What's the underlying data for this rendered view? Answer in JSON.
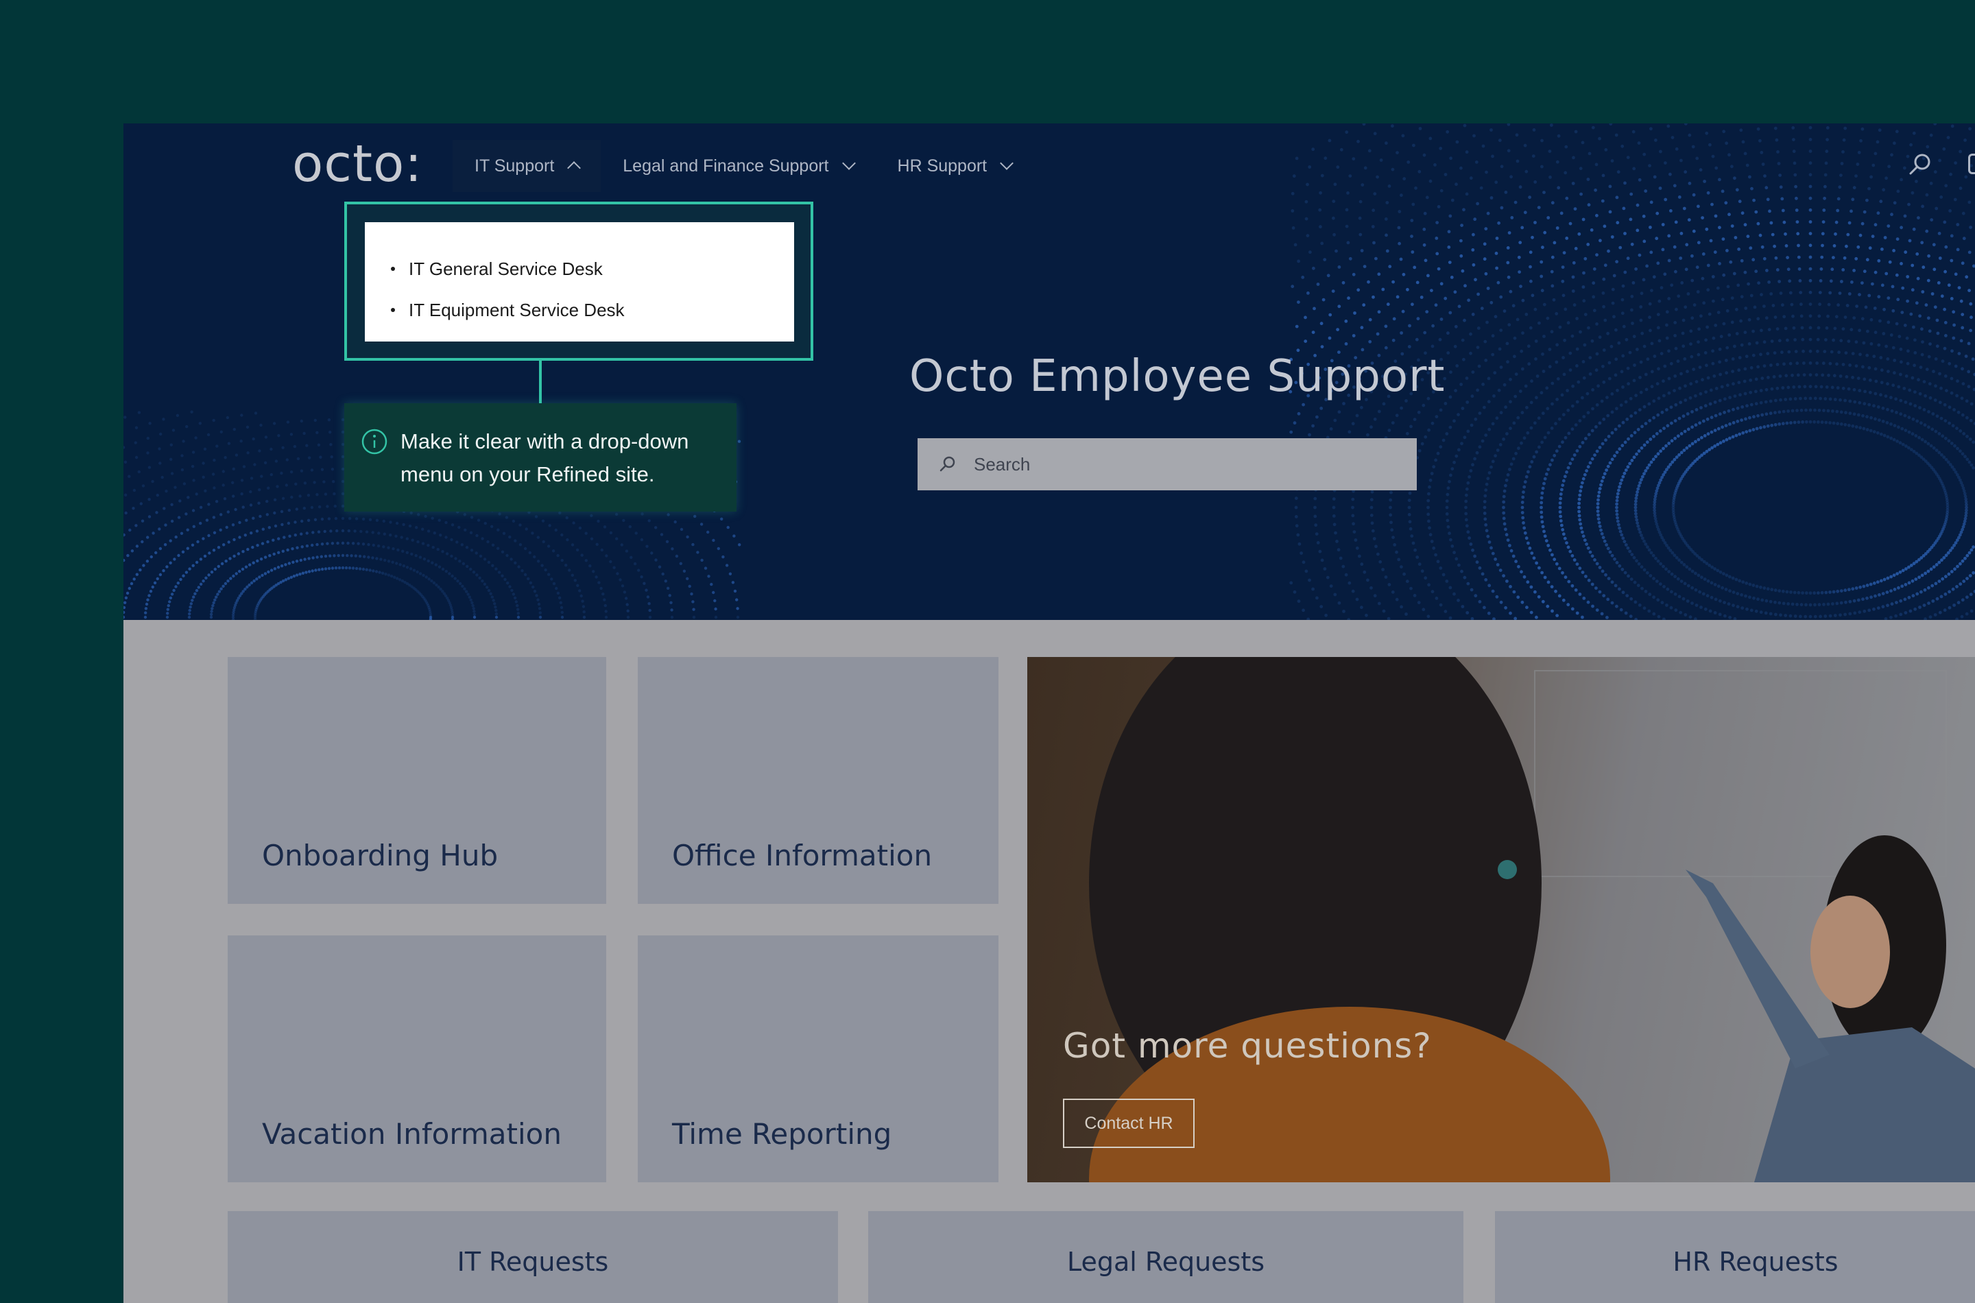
{
  "header": {
    "logo": "octo:",
    "nav": [
      {
        "label": "IT Support",
        "state": "expanded"
      },
      {
        "label": "Legal and Finance Support",
        "state": "collapsed"
      },
      {
        "label": "HR Support",
        "state": "collapsed"
      }
    ],
    "search_icon": "search-icon"
  },
  "dropdown": {
    "items": [
      "IT General Service Desk",
      "IT Equipment Service Desk"
    ]
  },
  "tooltip": {
    "icon": "info-icon",
    "text": "Make it clear with a drop-down menu on your Refined site."
  },
  "hero": {
    "title": "Octo Employee Support",
    "search_placeholder": "Search"
  },
  "cards": [
    "Onboarding Hub",
    "Office Information",
    "Vacation Information",
    "Time Reporting"
  ],
  "promo": {
    "title": "Got more questions?",
    "button": "Contact HR"
  },
  "bottom_cards": [
    "IT Requests",
    "Legal Requests",
    "HR Requests"
  ],
  "colors": {
    "outer_bg": "#023638",
    "hero_bg": "#061c3e",
    "accent": "#33c3a6",
    "tooltip_bg": "#0b3a36",
    "card_bg": "#8f939e"
  }
}
